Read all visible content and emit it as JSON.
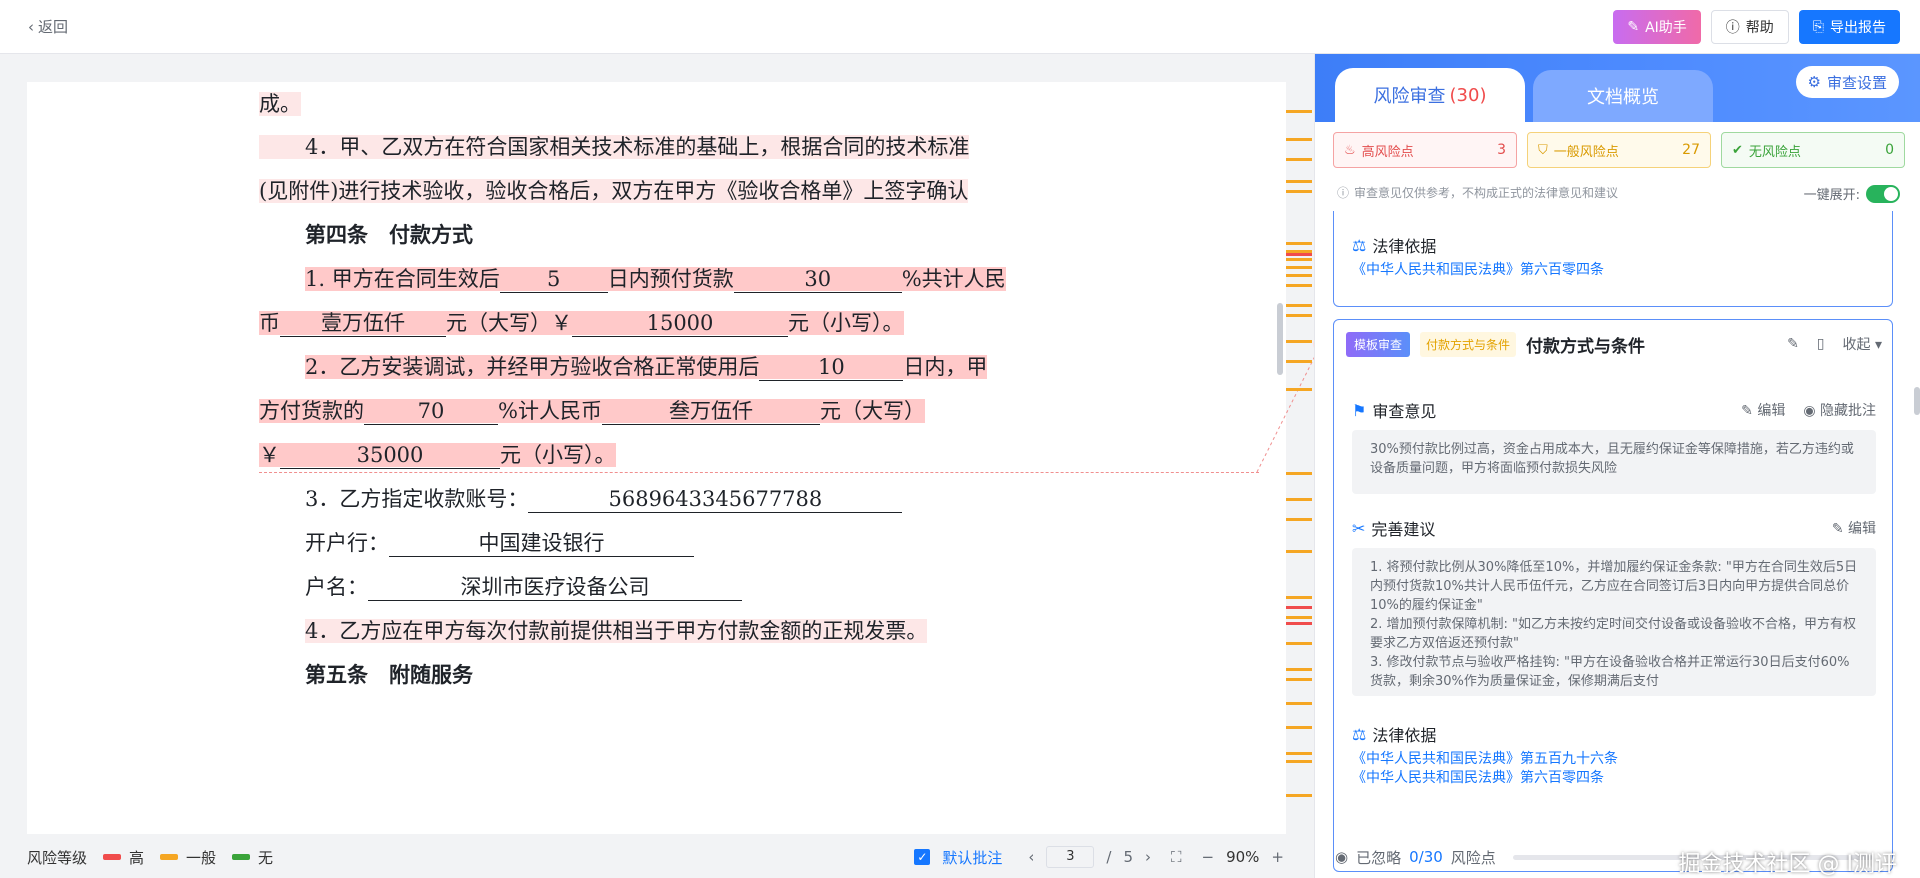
{
  "topbar": {
    "back_label": "返回",
    "ai_label": "AI助手",
    "help_label": "帮助",
    "export_label": "导出报告"
  },
  "document": {
    "lines": [
      "成。",
      "4．甲、乙双方在符合国家相关技术标准的基础上，根据合同的技术标准",
      "(见附件)进行技术验收，验收合格后，双方在甲方《验收合格单》上签字确认",
      "第四条　付款方式",
      "2．乙方安装调试，并经甲方验收合格正常使用后",
      "3．乙方指定收款账号：",
      "开户行：",
      "户名：",
      "4．乙方应在甲方每次付款前提供相当于甲方付款金额的正规发票。",
      "第五条　附随服务"
    ],
    "p1": {
      "a": "1. 甲方在合同生效后",
      "days": "5",
      "b": "日内预付货款",
      "pct": "30",
      "c": "%共计人民"
    },
    "p2": {
      "a": "币",
      "amount_cn": "壹万伍仟",
      "b": "元（大写）￥",
      "amount_num": "15000",
      "c": "元（小写）。"
    },
    "p3": {
      "days": "10",
      "c": "日内，甲"
    },
    "p4": {
      "a": "方付货款的",
      "pct": "70",
      "b": "%计人民币",
      "amount_cn": "叁万伍仟",
      "c": "元（大写）"
    },
    "p5": {
      "a": "￥",
      "amount_num": "35000",
      "c": "元（小写）。"
    },
    "account_no": "5689643345677788",
    "bank": "中国建设银行",
    "account_name": "深圳市医疗设备公司"
  },
  "bottombar": {
    "legend_label": "风险等级",
    "high": "高",
    "mid": "一般",
    "none": "无",
    "default_annot": "默认批注",
    "page_current": "3",
    "page_sep": "/",
    "page_total": "5",
    "zoom": "90%",
    "minus": "−",
    "plus": "+"
  },
  "panel": {
    "tab_review": "风险审查",
    "tab_review_count": "(30)",
    "tab_overview": "文档概览",
    "settings": "审查设置",
    "risk_high_label": "高风险点",
    "risk_high_count": "3",
    "risk_mid_label": "一般风险点",
    "risk_mid_count": "27",
    "risk_none_label": "无风险点",
    "risk_none_count": "0",
    "disclaimer": "审查意见仅供参考，不构成正式的法律意见和建议",
    "expand_all": "一键展开:",
    "prev_card": {
      "law_title": "法律依据",
      "law_link": "《中华人民共和国民法典》第六百零四条"
    },
    "card": {
      "tag_template": "模板审查",
      "tag_category": "付款方式与条件",
      "title": "付款方式与条件",
      "collapse": "收起",
      "opinion_title": "审查意见",
      "edit": "编辑",
      "hide_annot": "隐藏批注",
      "opinion_text": "30%预付款比例过高，资金占用成本大，且无履约保证金等保障措施，若乙方违约或设备质量问题，甲方将面临预付款损失风险",
      "suggest_title": "完善建议",
      "suggestions": [
        "1. 将预付款比例从30%降低至10%，并增加履约保证金条款: \"甲方在合同生效后5日内预付货款10%共计人民币伍仟元，乙方应在合同签订后3日内向甲方提供合同总价10%的履约保证金\"",
        "2. 增加预付款保障机制: \"如乙方未按约定时间交付设备或设备验收不合格，甲方有权要求乙方双倍返还预付款\"",
        "3. 修改付款节点与验收严格挂钩: \"甲方在设备验收合格并正常运行30日后支付60%货款，剩余30%作为质量保证金，保修期满后支付"
      ],
      "law_title": "法律依据",
      "law_links": [
        "《中华人民共和国民法典》第五百九十六条",
        "《中华人民共和国民法典》第六百零四条"
      ]
    },
    "footer": {
      "ignored_prefix": "已忽略",
      "ignored_count": "0/30",
      "ignored_suffix": "风险点"
    },
    "watermark": "掘金技术社区 @ I测评"
  },
  "colors": {
    "accent": "#1677ff",
    "high": "#f04c4c",
    "mid": "#f5a623",
    "none": "#3aa33a",
    "highlight": "#ffc9c9"
  }
}
